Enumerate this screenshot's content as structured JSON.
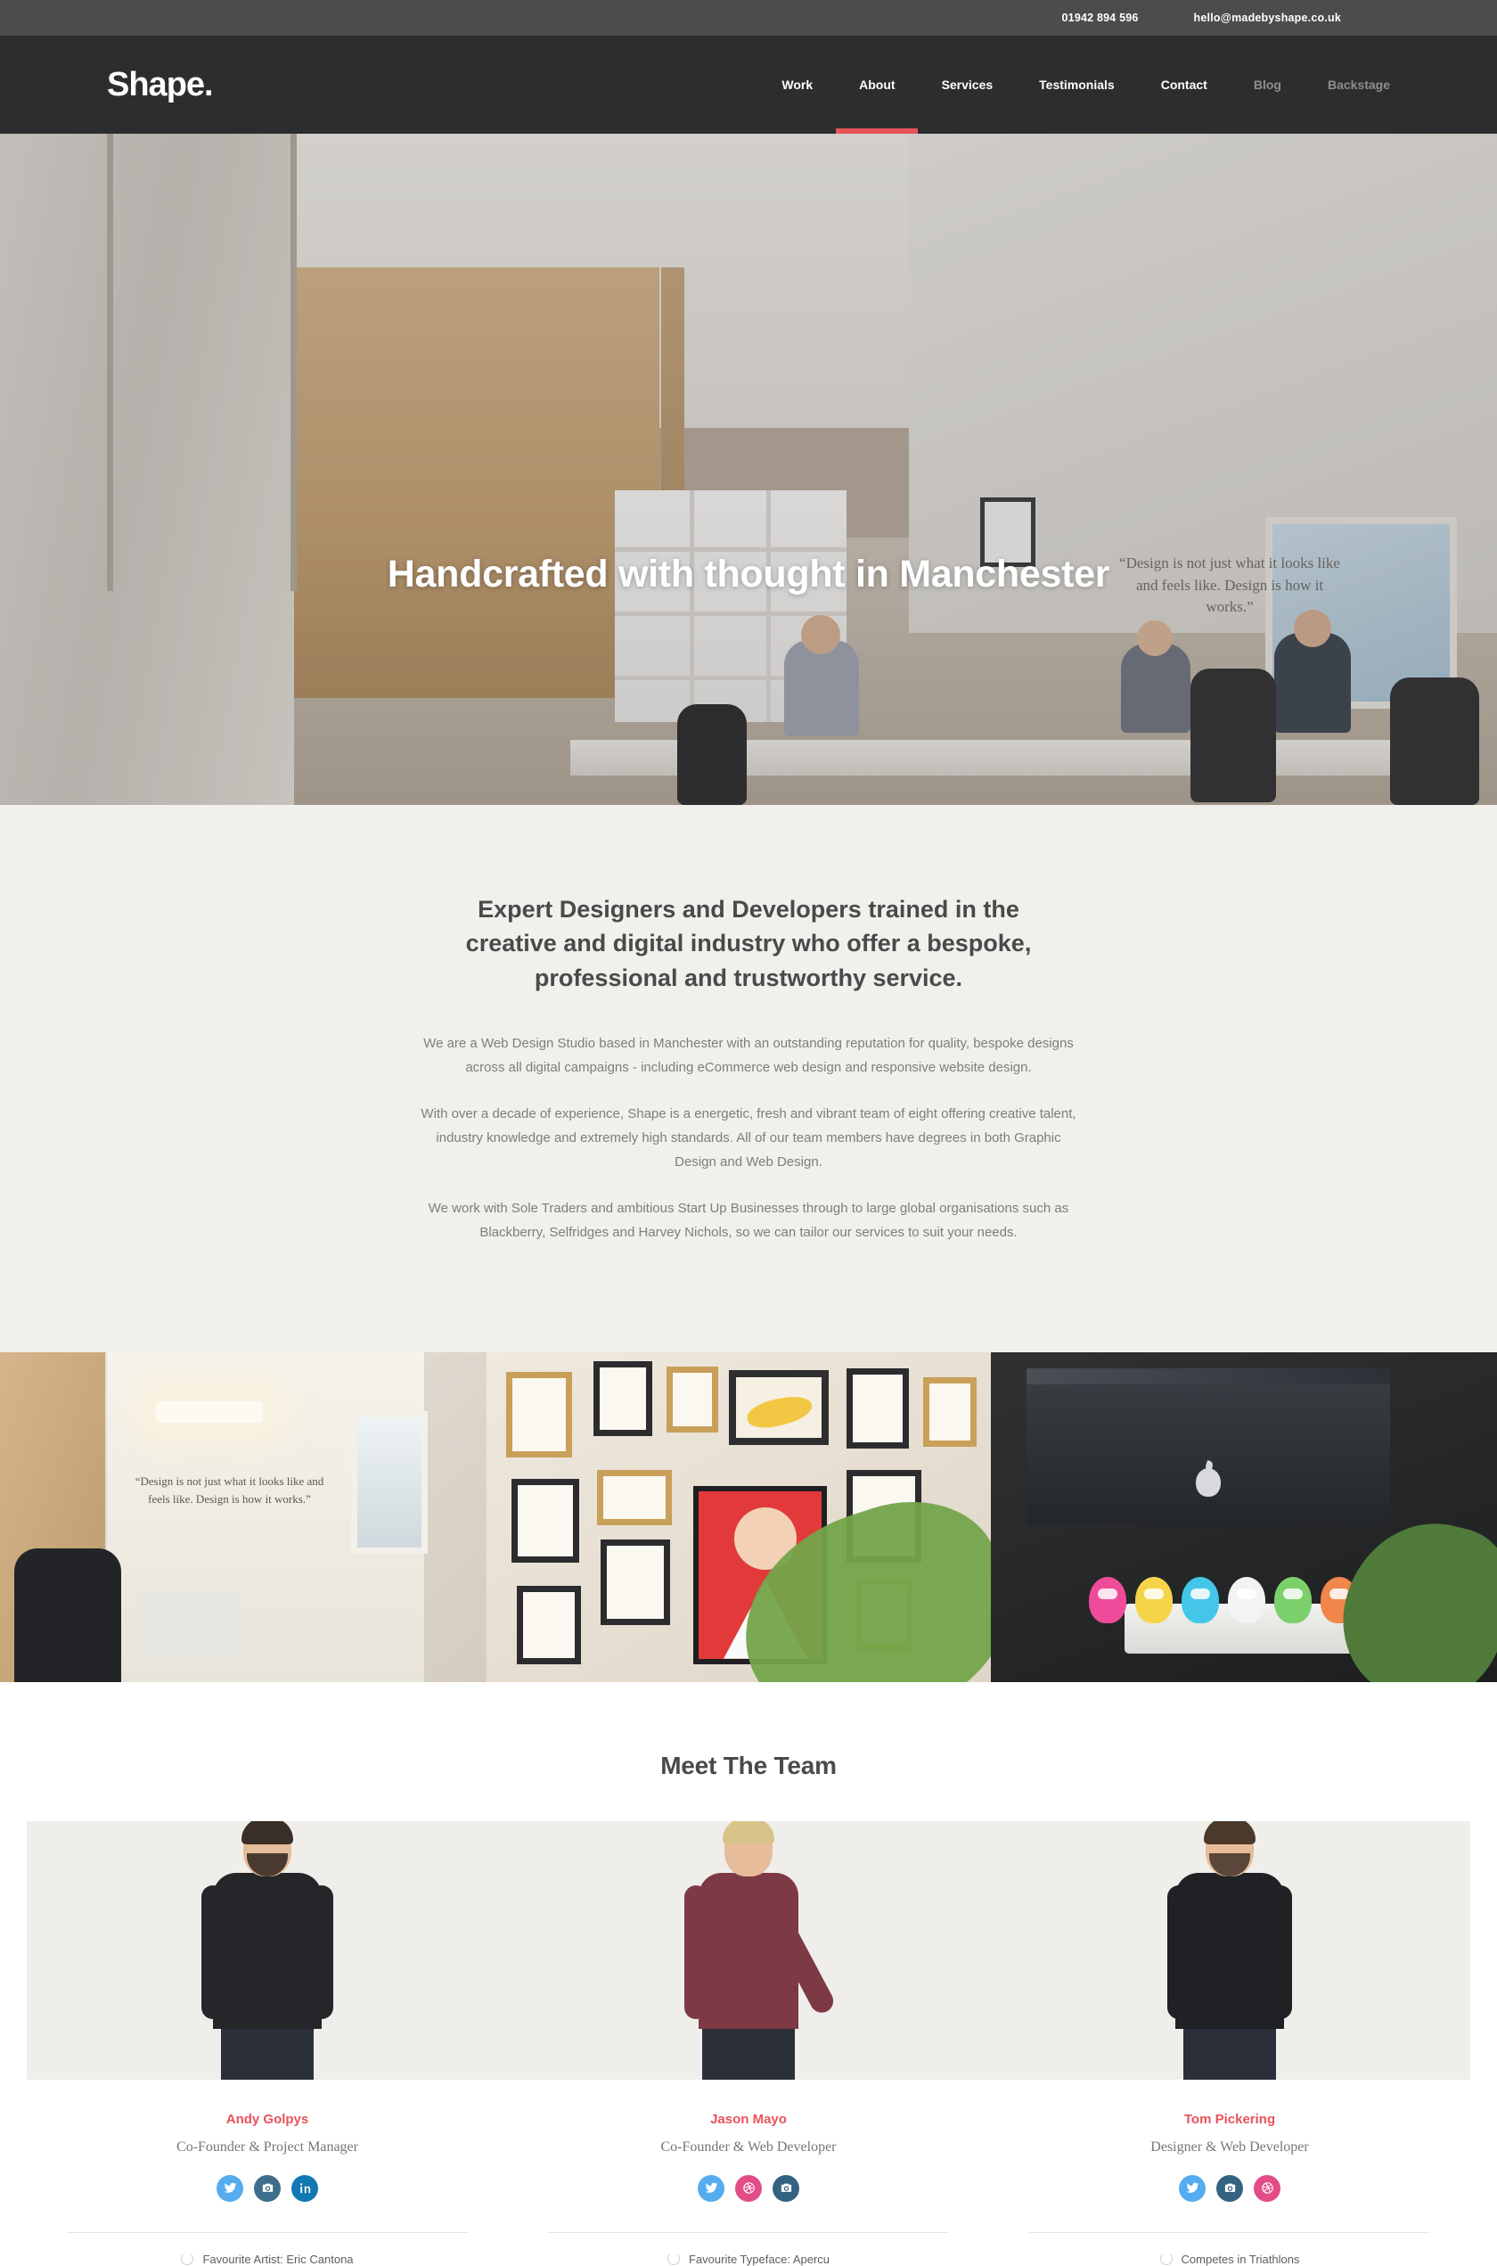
{
  "topbar": {
    "phone": "01942 894 596",
    "email": "hello@madebyshape.co.uk"
  },
  "nav": {
    "logo": "Shape.",
    "accent_color": "#e8535a",
    "items": [
      {
        "label": "Work",
        "state": "normal",
        "active": false
      },
      {
        "label": "About",
        "state": "normal",
        "active": true
      },
      {
        "label": "Services",
        "state": "normal",
        "active": false
      },
      {
        "label": "Testimonials",
        "state": "normal",
        "active": false
      },
      {
        "label": "Contact",
        "state": "normal",
        "active": false
      },
      {
        "label": "Blog",
        "state": "dim",
        "active": false
      },
      {
        "label": "Backstage",
        "state": "dim",
        "active": false
      }
    ]
  },
  "hero": {
    "title": "Handcrafted with thought in Manchester",
    "wall_quote": "“Design is not just what it looks like and feels like. Design is how it works.”"
  },
  "intro": {
    "heading": "Expert Designers and Developers trained in the creative and digital industry who offer a bespoke, professional and trustworthy service.",
    "paragraphs": [
      "We are a Web Design Studio based in Manchester with an outstanding reputation for quality, bespoke designs across all digital campaigns - including eCommerce web design and responsive website design.",
      "With over a decade of experience, Shape is a energetic, fresh and vibrant team of eight offering creative talent, industry knowledge and extremely high standards. All of our team members have degrees in both Graphic Design and Web Design.",
      "We work with Sole Traders and ambitious Start Up Businesses through to large global organisations such as Blackberry, Selfridges and Harvey Nichols, so we can tailor our services to suit your needs."
    ]
  },
  "photo_strip": {
    "panel_one_quote": "“Design is not just what it looks like and feels like. Design is how it works.”"
  },
  "team": {
    "heading": "Meet The Team",
    "members": [
      {
        "name": "Andy Golpys",
        "role": "Co-Founder & Project Manager",
        "fact": "Favourite Artist: Eric Cantona",
        "socials": [
          {
            "name": "twitter-icon",
            "color": "#55acee"
          },
          {
            "name": "instagram-icon",
            "color": "#3f6e8c"
          },
          {
            "name": "linkedin-icon",
            "color": "#1178b3"
          }
        ],
        "shirt_color": "#25262a",
        "hair_color": "#3a2f28",
        "beard_color": "#4a3b31"
      },
      {
        "name": "Jason Mayo",
        "role": "Co-Founder & Web Developer",
        "fact": "Favourite Typeface: Apercu",
        "socials": [
          {
            "name": "twitter-icon",
            "color": "#55acee"
          },
          {
            "name": "dribbble-icon",
            "color": "#e24d87"
          },
          {
            "name": "instagram-icon",
            "color": "#336381"
          }
        ],
        "shirt_color": "#7d3a44",
        "hair_color": "#d8c48a",
        "beard_color": "transparent"
      },
      {
        "name": "Tom Pickering",
        "role": "Designer & Web Developer",
        "fact": "Competes in Triathlons",
        "socials": [
          {
            "name": "twitter-icon",
            "color": "#55acee"
          },
          {
            "name": "instagram-icon",
            "color": "#336381"
          },
          {
            "name": "dribbble-icon",
            "color": "#e24d87"
          }
        ],
        "shirt_color": "#1f2125",
        "hair_color": "#4b3a2c",
        "beard_color": "#5a463a"
      }
    ]
  }
}
